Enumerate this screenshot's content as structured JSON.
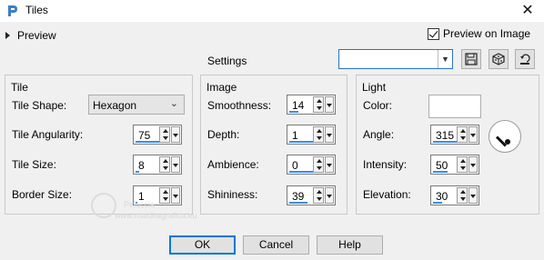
{
  "window": {
    "title": "Tiles"
  },
  "preview": {
    "label": "Preview",
    "preview_on_image_label": "Preview on Image",
    "preview_on_image_checked": true
  },
  "settings": {
    "label": "Settings",
    "value": ""
  },
  "tile": {
    "title": "Tile",
    "shape_label": "Tile Shape:",
    "shape_value": "Hexagon",
    "angularity_label": "Tile Angularity:",
    "angularity_value": "75",
    "size_label": "Tile Size:",
    "size_value": "8",
    "border_label": "Border Size:",
    "border_value": "1"
  },
  "image": {
    "title": "Image",
    "smoothness_label": "Smoothness:",
    "smoothness_value": "14",
    "depth_label": "Depth:",
    "depth_value": "1",
    "ambience_label": "Ambience:",
    "ambience_value": "0",
    "shininess_label": "Shininess:",
    "shininess_value": "39"
  },
  "light": {
    "title": "Light",
    "color_label": "Color:",
    "color_value": "#ffffff",
    "angle_label": "Angle:",
    "angle_value": "315",
    "intensity_label": "Intensity:",
    "intensity_value": "50",
    "elevation_label": "Elevation:",
    "elevation_value": "30"
  },
  "watermark": {
    "name": "Pinuccia",
    "site": "www.maidiragrafica.eu"
  },
  "buttons": {
    "ok": "OK",
    "cancel": "Cancel",
    "help": "Help"
  },
  "colors": {
    "accent": "#0078d7",
    "slider_bar": "#3c8be0"
  }
}
